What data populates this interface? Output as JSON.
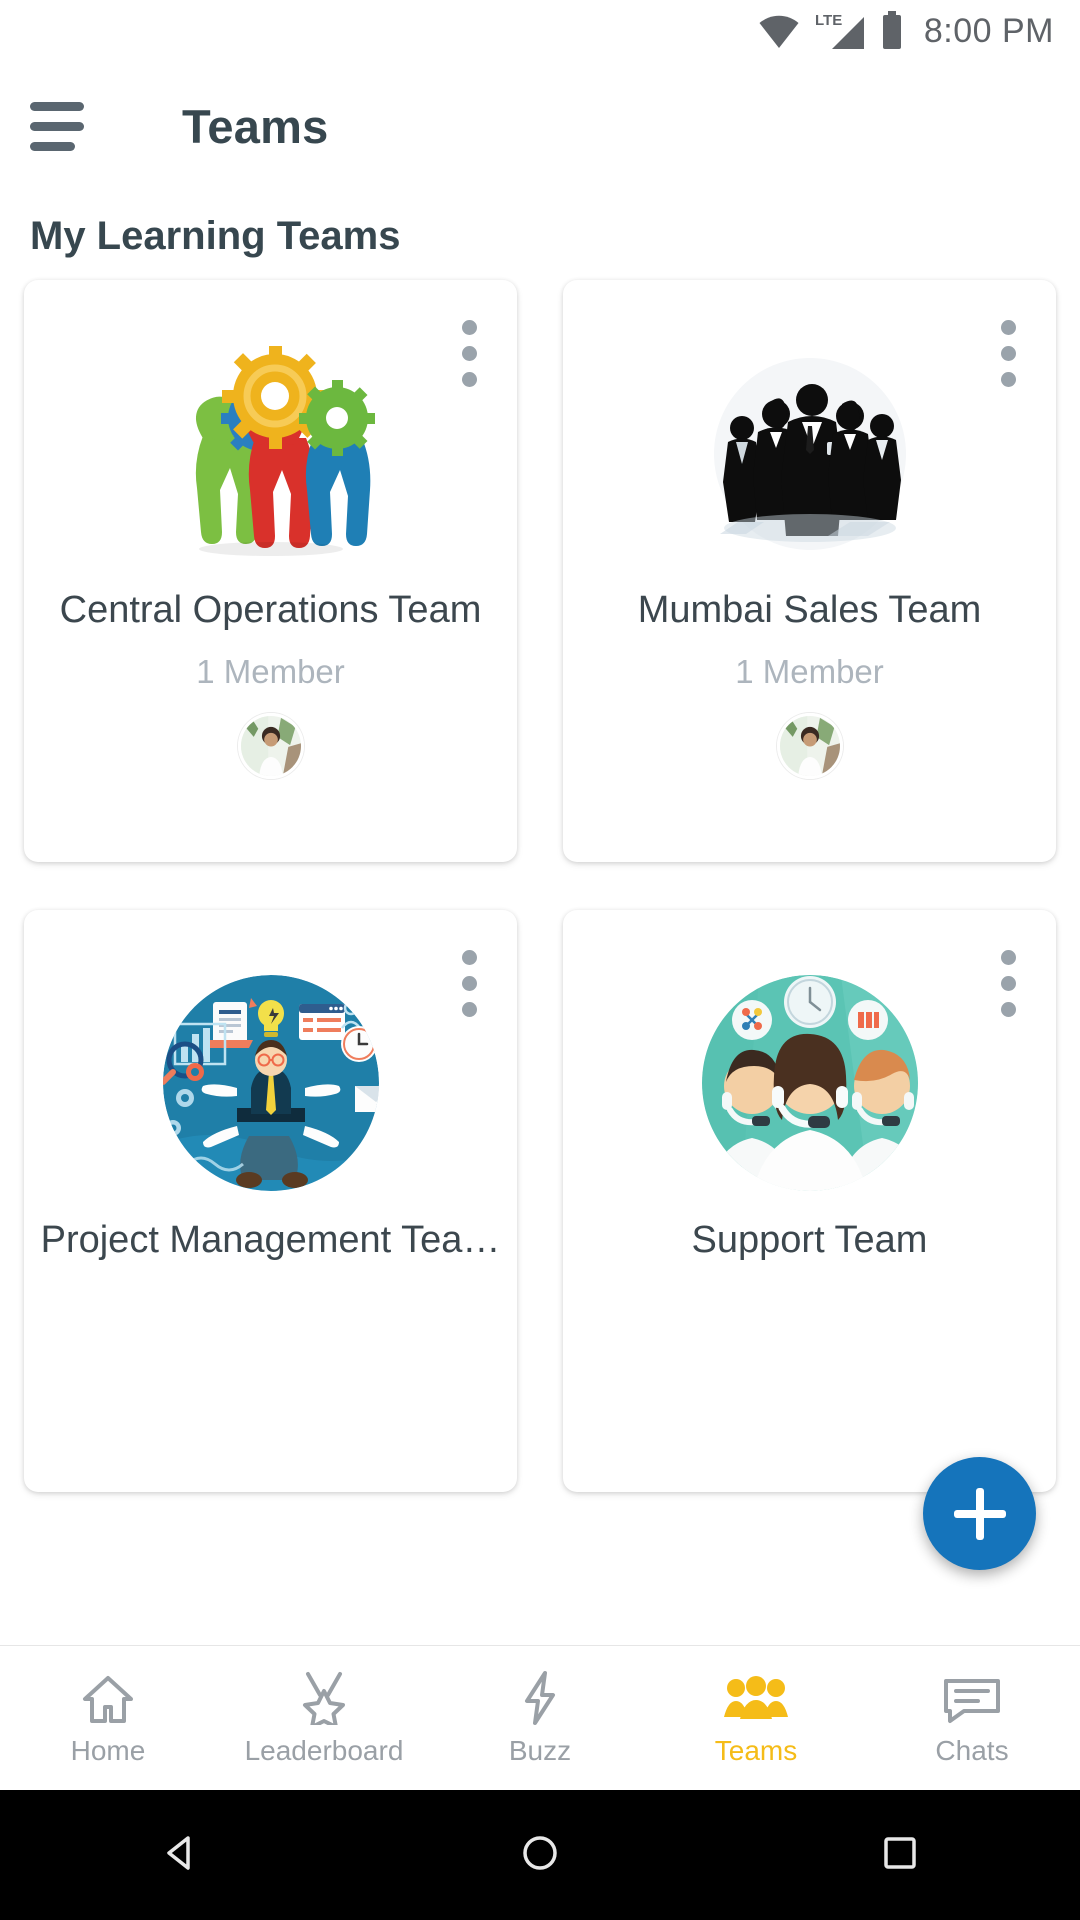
{
  "status_bar": {
    "time": "8:00 PM",
    "network_label": "LTE",
    "icons": [
      "wifi-icon",
      "lte-signal-icon",
      "battery-icon"
    ]
  },
  "appbar": {
    "menu_icon": "hamburger-menu-icon",
    "title": "Teams"
  },
  "section": {
    "header": "My Learning Teams"
  },
  "teams": [
    {
      "title": "Central Operations Team",
      "members": "1 Member",
      "art": "gears-teamwork-illustration",
      "menu_icon": "overflow-menu-icon",
      "avatar": "member-avatar"
    },
    {
      "title": "Mumbai Sales Team",
      "members": "1 Member",
      "art": "business-team-silhouette-illustration",
      "menu_icon": "overflow-menu-icon",
      "avatar": "member-avatar"
    },
    {
      "title": "Project Management Tea…",
      "members": "",
      "art": "project-manager-illustration",
      "menu_icon": "overflow-menu-icon",
      "avatar": ""
    },
    {
      "title": "Support Team",
      "members": "",
      "art": "support-agents-illustration",
      "menu_icon": "overflow-menu-icon",
      "avatar": ""
    }
  ],
  "fab": {
    "icon": "plus-icon",
    "color": "#1574bb"
  },
  "bottom_nav": {
    "active_color": "#f5bc18",
    "inactive_color": "#9aa0a6",
    "items": [
      {
        "label": "Home",
        "icon": "home-icon",
        "active": false
      },
      {
        "label": "Leaderboard",
        "icon": "medal-icon",
        "active": false
      },
      {
        "label": "Buzz",
        "icon": "lightning-icon",
        "active": false
      },
      {
        "label": "Teams",
        "icon": "people-group-icon",
        "active": true
      },
      {
        "label": "Chats",
        "icon": "chat-bubble-icon",
        "active": false
      }
    ]
  },
  "system_nav": {
    "back": "back-triangle-icon",
    "home": "home-circle-icon",
    "recents": "recents-square-icon"
  }
}
